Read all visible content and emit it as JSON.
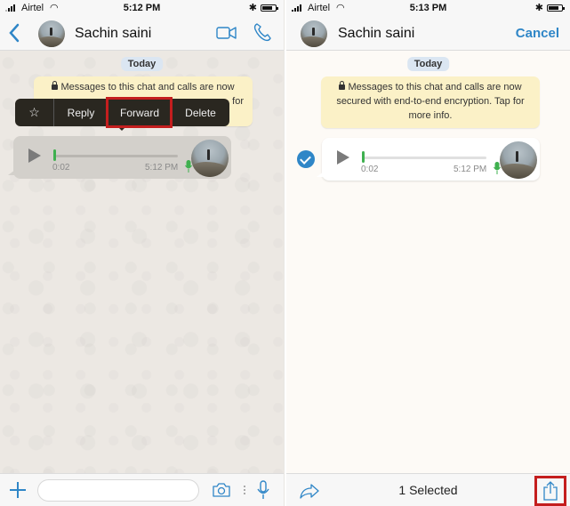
{
  "left_screen": {
    "status_bar": {
      "carrier": "Airtel",
      "time": "5:12 PM",
      "wifi_icon": "wifi-icon",
      "bluetooth_icon": "bluetooth-icon",
      "battery_icon": "battery-icon"
    },
    "header": {
      "back_icon": "chevron-left-icon",
      "contact_name": "Sachin saini",
      "video_call_icon": "video-camera-icon",
      "voice_call_icon": "phone-icon"
    },
    "date_label": "Today",
    "encryption_notice": {
      "text_line1": "Messages to this chat and calls are now",
      "text_line2_visible": "for"
    },
    "context_menu": {
      "star_glyph": "☆",
      "items": [
        "Reply",
        "Forward",
        "Delete"
      ],
      "highlighted": "Forward"
    },
    "voice_message": {
      "duration": "0:02",
      "time": "5:12 PM",
      "progress": 0
    },
    "input_bar": {
      "message_value": "",
      "add_icon": "plus-icon",
      "camera_icon": "camera-icon",
      "mic_icon": "microphone-icon"
    }
  },
  "right_screen": {
    "status_bar": {
      "carrier": "Airtel",
      "time": "5:13 PM",
      "wifi_icon": "wifi-icon",
      "bluetooth_icon": "bluetooth-icon",
      "battery_icon": "battery-icon"
    },
    "header": {
      "contact_name": "Sachin saini",
      "cancel_label": "Cancel"
    },
    "date_label": "Today",
    "encryption_notice": {
      "line1": "Messages to this chat and calls are now",
      "line2": "secured with end-to-end encryption. Tap for",
      "line3": "more info."
    },
    "voice_message": {
      "duration": "0:02",
      "time": "5:12 PM",
      "selected": true,
      "progress": 0
    },
    "bottom_bar": {
      "forward_icon": "forward-arrow-icon",
      "selected_label": "1 Selected",
      "share_icon": "share-icon",
      "share_highlighted": true
    }
  },
  "colors": {
    "accent": "#2f86c7",
    "highlight_box": "#c41e1e",
    "mic_green": "#3fb04f",
    "notice_bg": "#fbf1c7",
    "date_pill_bg": "#dbe6f2",
    "menu_bg": "#2a2720"
  }
}
